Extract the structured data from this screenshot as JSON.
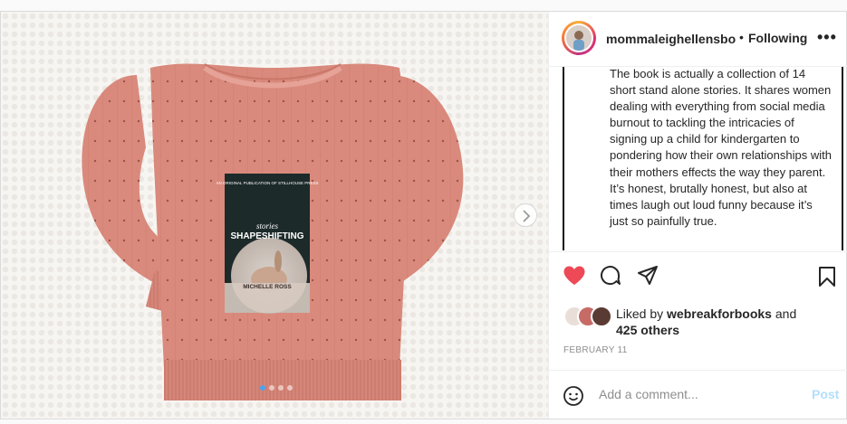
{
  "post": {
    "username": "mommaleighellensbooks",
    "separator": "•",
    "follow_label": "Following",
    "more_icon": "more-options-icon",
    "more_label": "•••",
    "caption": "The book is actually a collection of 14 short stand alone stories. It shares women dealing with everything from social media burnout to tackling the intricacies of signing up a child for kindergarten to pondering how their own relationships with their mothers effects the way they parent. It’s honest, brutally honest, but also at times laugh out loud funny because it’s just so painfully true.",
    "liked_prefix": "Liked by",
    "liked_user": "webreakforbooks",
    "liked_and": "and",
    "liked_others": "425 others",
    "timestamp": "FEBRUARY 11",
    "comment_placeholder": "Add a comment...",
    "post_label": "Post"
  },
  "book": {
    "publisher_line": "AN ORIGINAL PUBLICATION OF STILLHOUSE PRESS",
    "subtitle": "stories",
    "title": "SHAPESHIFTING",
    "author": "MICHELLE ROSS"
  },
  "carousel": {
    "total": 4,
    "current": 1
  },
  "colors": {
    "heart": "#ed4956",
    "post_disabled": "#b2dffc",
    "dot_active": "#4aa3f0",
    "sweater": "#d98a7c"
  },
  "icons": [
    "heart-icon",
    "comment-icon",
    "share-icon",
    "bookmark-icon",
    "emoji-icon",
    "chevron-right-icon"
  ]
}
